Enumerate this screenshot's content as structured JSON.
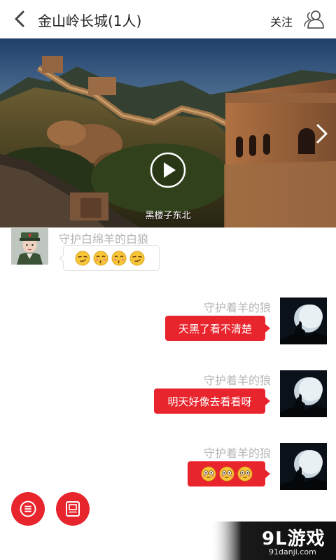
{
  "header": {
    "title": "金山岭长城(1人)",
    "follow_label": "关注"
  },
  "banner": {
    "caption": "黑楼子东北"
  },
  "messages": [
    {
      "side": "left",
      "sender": "守护白绵羊的白狼",
      "emojis": [
        "smirk-face-emoji",
        "kissing-face-emoji",
        "kissing-face-emoji",
        "smirk-face-emoji"
      ]
    },
    {
      "side": "right",
      "sender": "守护着羊的狼",
      "text": "天黑了看不清楚"
    },
    {
      "side": "right",
      "sender": "守护着羊的狼",
      "text": "明天好像去看看呀"
    },
    {
      "side": "right",
      "sender": "守护着羊的狼",
      "emojis": [
        "flushed-face-emoji",
        "flushed-face-emoji",
        "flushed-face-emoji"
      ]
    }
  ],
  "watermark": {
    "brand": "9L游戏",
    "url": "91danji.com"
  },
  "colors": {
    "accent": "#e8242c",
    "name_text": "#b5b5b5"
  }
}
